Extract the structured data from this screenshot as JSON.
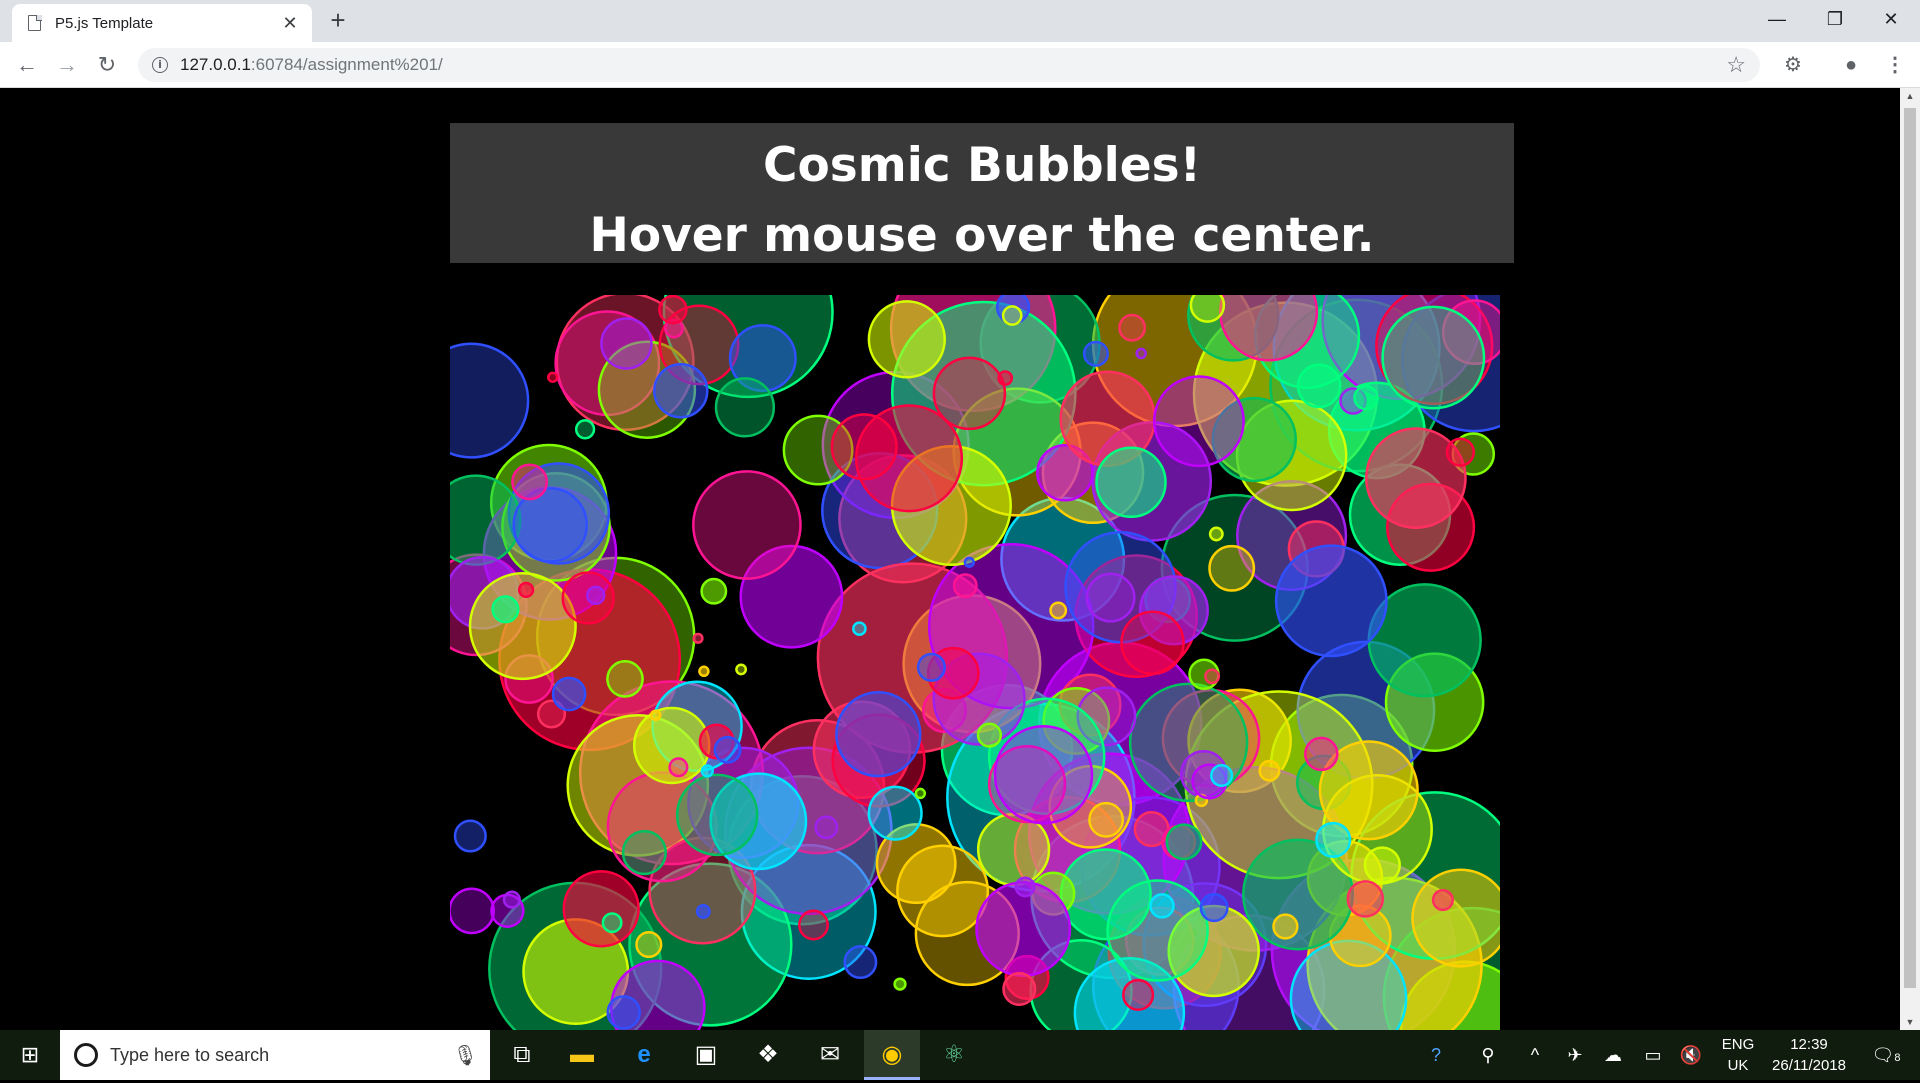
{
  "browser": {
    "tab_title": "P5.js Template",
    "tab_close": "✕",
    "new_tab": "+",
    "url_host": "127.0.0.1",
    "url_path": ":60784/assignment%201/",
    "win_min": "—",
    "win_restore": "❐",
    "win_close": "✕"
  },
  "page": {
    "title_line1": "Cosmic Bubbles!",
    "title_line2": "Hover mouse over the center."
  },
  "taskbar": {
    "search_placeholder": "Type here to search",
    "lang_line1": "ENG",
    "lang_line2": "UK",
    "time": "12:39",
    "date": "26/11/2018",
    "notification_count": "8"
  },
  "colors": {
    "bubble_palette": [
      "#ff0040",
      "#ff1493",
      "#00ff7f",
      "#00e5ff",
      "#3050ff",
      "#a020f0",
      "#d4ff00",
      "#7fff00",
      "#ffd000",
      "#00c060",
      "#c000ff",
      "#ff3060"
    ]
  }
}
